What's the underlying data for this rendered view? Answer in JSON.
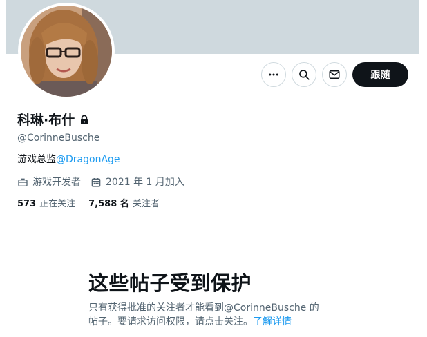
{
  "profile": {
    "display_name": "科琳·布什",
    "handle": "@CorinneBusche",
    "bio_prefix": "游戏总监",
    "bio_mention": "@DragonAge",
    "occupation": "游戏开发者",
    "joined": "2021 年 1 月加入",
    "following_count": "573",
    "following_label": "正在关注",
    "followers_count": "7,588 名",
    "followers_label": "关注者"
  },
  "actions": {
    "follow_label": "跟随",
    "more_icon": "more-icon",
    "search_icon": "search-icon",
    "message_icon": "mail-icon"
  },
  "protected": {
    "title": "这些帖子受到保护",
    "line1": "只有获得批准的关注者才能看到@CorinneBusche 的",
    "line2": "帖子。要请求访问权限，请点击关注。",
    "learn_more": "了解详情"
  },
  "colors": {
    "banner": "#cfd9de",
    "accent": "#1d9bf0",
    "button_dark": "#0f1419",
    "secondary_text": "#536471"
  }
}
